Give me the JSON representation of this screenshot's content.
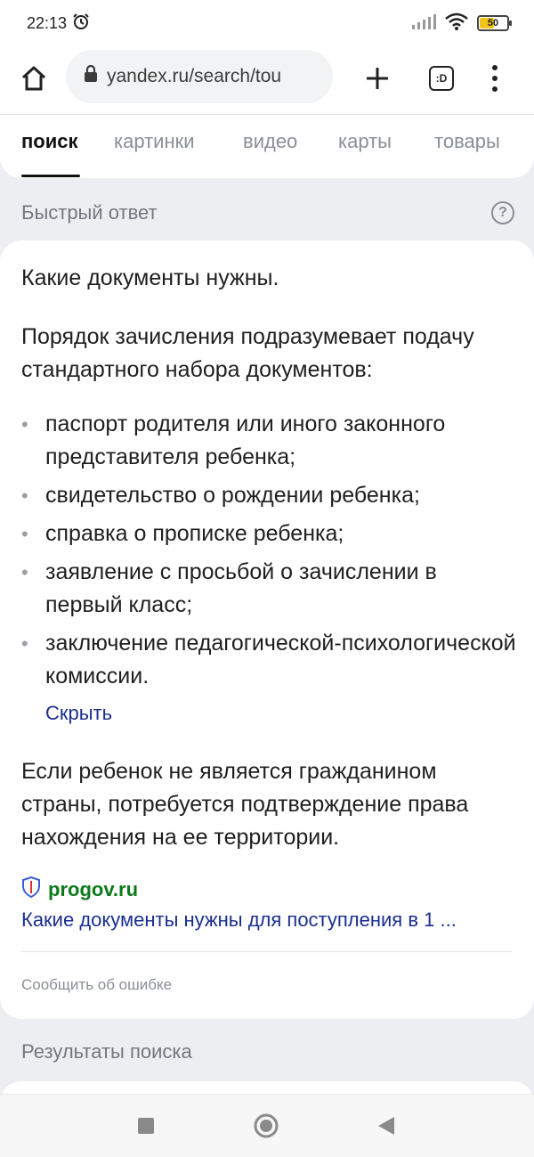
{
  "status_bar": {
    "time": "22:13",
    "battery": "50",
    "icons": [
      "alarm-icon",
      "signal-icon",
      "wifi-icon",
      "battery-icon"
    ]
  },
  "browser": {
    "url": "yandex.ru/search/tou",
    "tab_count": ":D",
    "icons": [
      "home-icon",
      "lock-icon",
      "plus-icon",
      "tabs-icon",
      "menu-icon"
    ]
  },
  "search_tabs": [
    {
      "label": "поиск",
      "active": true
    },
    {
      "label": "картинки",
      "active": false
    },
    {
      "label": "видео",
      "active": false
    },
    {
      "label": "карты",
      "active": false
    },
    {
      "label": "товары",
      "active": false
    }
  ],
  "quick_answer": {
    "header": "Быстрый ответ",
    "title": "Какие документы нужны.",
    "intro": "Порядок зачисления подразумевает подачу стандартного набора документов:",
    "items": [
      "паспорт родителя или иного законного представителя ребенка;",
      "свидетельство о рождении ребенка;",
      "справка о прописке ребенка;",
      "заявление с просьбой о зачислении в первый класс;",
      "заключение педагогической-психологической комиссии."
    ],
    "hide_label": "Скрыть",
    "note": "Если ребенок не является гражданином страны, потребуется подтверждение права нахождения на ее территории.",
    "source_name": "progov.ru",
    "source_title": "Какие документы нужны для поступления в 1 ...",
    "report_label": "Сообщить об ошибке"
  },
  "results_header": "Результаты поиска",
  "colors": {
    "background": "#edeef2",
    "link": "#1a2e8f",
    "source_green": "#0c7a1a",
    "muted": "#8a8e98"
  }
}
